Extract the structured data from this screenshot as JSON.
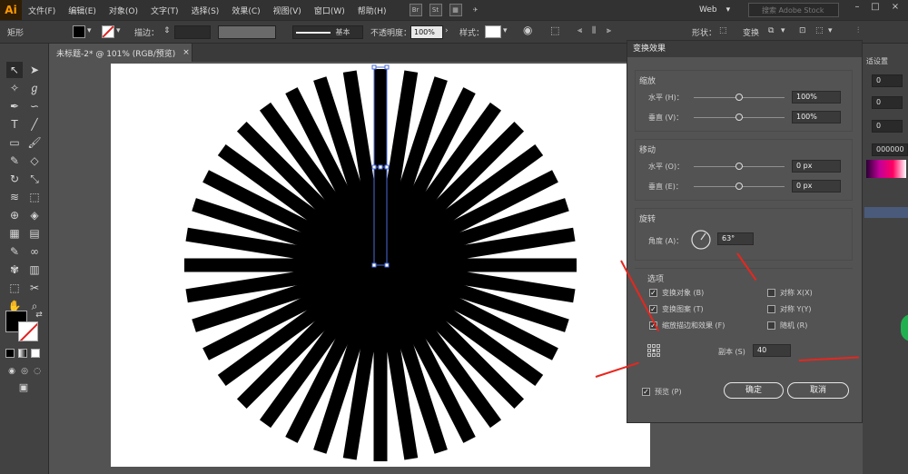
{
  "app": {
    "logo": "Ai",
    "menu": [
      "文件(F)",
      "编辑(E)",
      "对象(O)",
      "文字(T)",
      "选择(S)",
      "效果(C)",
      "视图(V)",
      "窗口(W)",
      "帮助(H)"
    ],
    "bridge_labels": [
      "Br",
      "St"
    ],
    "workspace": "Web",
    "search_placeholder": "搜索 Adobe Stock"
  },
  "control_bar": {
    "object_type": "矩形",
    "stroke_label": "描边：",
    "brush_label": "基本",
    "opacity_label": "不透明度：",
    "opacity_value": "100%",
    "style_label": "样式：",
    "shape_label": "形状：",
    "transform_label": "变换"
  },
  "document": {
    "tab_title": "未标题-2* @ 101% (RGB/预览)",
    "close": "×"
  },
  "right_panel": {
    "label": "适设置",
    "fields": [
      "0",
      "0",
      "0",
      "000000"
    ]
  },
  "dialog": {
    "title": "变换效果",
    "scale": {
      "title": "缩放",
      "horizontal_label": "水平 (H)：",
      "horizontal_value": "100%",
      "vertical_label": "垂直 (V)：",
      "vertical_value": "100%"
    },
    "move": {
      "title": "移动",
      "horizontal_label": "水平 (O)：",
      "horizontal_value": "0 px",
      "vertical_label": "垂直 (E)：",
      "vertical_value": "0 px"
    },
    "rotate": {
      "title": "旋转",
      "angle_label": "角度 (A)：",
      "angle_value": "63°"
    },
    "options": {
      "title": "选项",
      "transform_objects": "变换对象 (B)",
      "transform_patterns": "变换图案 (T)",
      "scale_strokes": "缩放描边和效果 (F)",
      "reflect_x": "对称 X(X)",
      "reflect_y": "对称 Y(Y)",
      "random": "随机 (R)"
    },
    "copies_label": "副本 (S)",
    "copies_value": "40",
    "preview_label": "预览 (P)",
    "ok_label": "确定",
    "cancel_label": "取消"
  },
  "colors": {
    "accent_arrow": "#e8261e",
    "artwork": "#000000",
    "selection": "#4a6bd8"
  }
}
